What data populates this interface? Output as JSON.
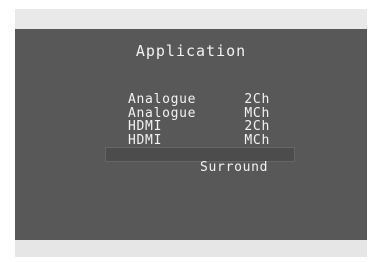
{
  "screen": {
    "title": "Application",
    "menu": [
      {
        "label": "Analogue",
        "value": "2Ch"
      },
      {
        "label": "Analogue",
        "value": "MCh"
      },
      {
        "label": "HDMI",
        "value": "2Ch"
      },
      {
        "label": "HDMI",
        "value": "MCh"
      },
      {
        "label": "Surround",
        "value": ""
      }
    ],
    "selected_index": 4
  },
  "colors": {
    "screen_background": "#585858",
    "text": "#f2f2f2",
    "selection_background": "#4c4c4c",
    "outer_band": "#e9e9e9"
  }
}
